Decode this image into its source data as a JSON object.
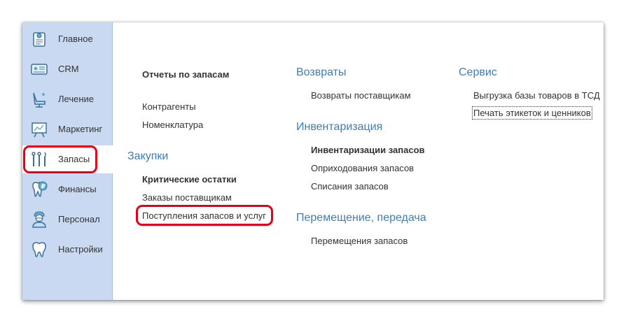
{
  "sidebar": {
    "items": [
      {
        "label": "Главное",
        "icon": "home-document-icon"
      },
      {
        "label": "CRM",
        "icon": "id-card-icon"
      },
      {
        "label": "Лечение",
        "icon": "dental-chair-icon"
      },
      {
        "label": "Маркетинг",
        "icon": "presentation-board-icon"
      },
      {
        "label": "Запасы",
        "icon": "dental-tools-icon"
      },
      {
        "label": "Финансы",
        "icon": "tooth-ruble-icon"
      },
      {
        "label": "Персонал",
        "icon": "doctor-icon"
      },
      {
        "label": "Настройки",
        "icon": "tooth-icon"
      }
    ],
    "active": "Запасы"
  },
  "columns": {
    "col1": {
      "reports_label": "Отчеты по запасам",
      "counterparties": "Контрагенты",
      "nomenclature": "Номенклатура",
      "purchases_heading": "Закупки",
      "critical_stock": "Критические остатки",
      "supplier_orders": "Заказы поставщикам",
      "receipts": "Поступления запасов и услуг"
    },
    "col2": {
      "returns_heading": "Возвраты",
      "supplier_returns": "Возвраты поставщикам",
      "inventory_heading": "Инвентаризация",
      "inventories": "Инвентаризации запасов",
      "stock_receipts": "Оприходования запасов",
      "write_offs": "Списания запасов",
      "transfer_heading": "Перемещение, передача",
      "transfers": "Перемещения запасов"
    },
    "col3": {
      "service_heading": "Сервис",
      "export_tsd": "Выгрузка базы товаров в ТСД",
      "print_labels": "Печать этикеток и ценников"
    }
  },
  "colors": {
    "accent_link": "#3c7fb6",
    "sidebar_bg": "#c8d9f1",
    "highlight": "#e4001b"
  }
}
